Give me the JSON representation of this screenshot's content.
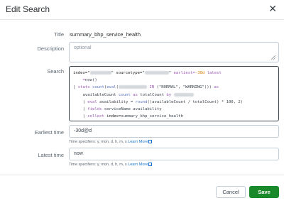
{
  "modal": {
    "title": "Edit Search",
    "close_icon": "close-icon"
  },
  "form": {
    "title_label": "Title",
    "title_value": "summary_bhp_service_health",
    "description_label": "Description",
    "description_placeholder": "optional",
    "search_label": "Search",
    "search_lines": [
      "index=\"        \" sourcetype=\"       \" earliest=-30d latest",
      "    =now()",
      "| stats count(eval(         IN (\"NORMAL\", \"WARNING\"))) as",
      "    availableCount count as totalCount by",
      "    | eval availability = round((availableCount / totalCount) * 100, 2)",
      "    | fields serviceName availability",
      "    | collect index=summary_bhp_service_health"
    ],
    "earliest_label": "Earliest time",
    "earliest_value": "-30d@d",
    "earliest_hint": "Time specifiers: y, mon, d, h, m, s",
    "learn_more": "Learn More",
    "latest_label": "Latest time",
    "latest_value": "now",
    "latest_hint": "Time specifiers: y, mon, d, h, m, s"
  },
  "footer": {
    "cancel_label": "Cancel",
    "save_label": "Save"
  },
  "colors": {
    "save_bg": "#1a8929",
    "link": "#1a73c6",
    "command_purple": "#9b57b5",
    "function_blue": "#5b73c4"
  }
}
